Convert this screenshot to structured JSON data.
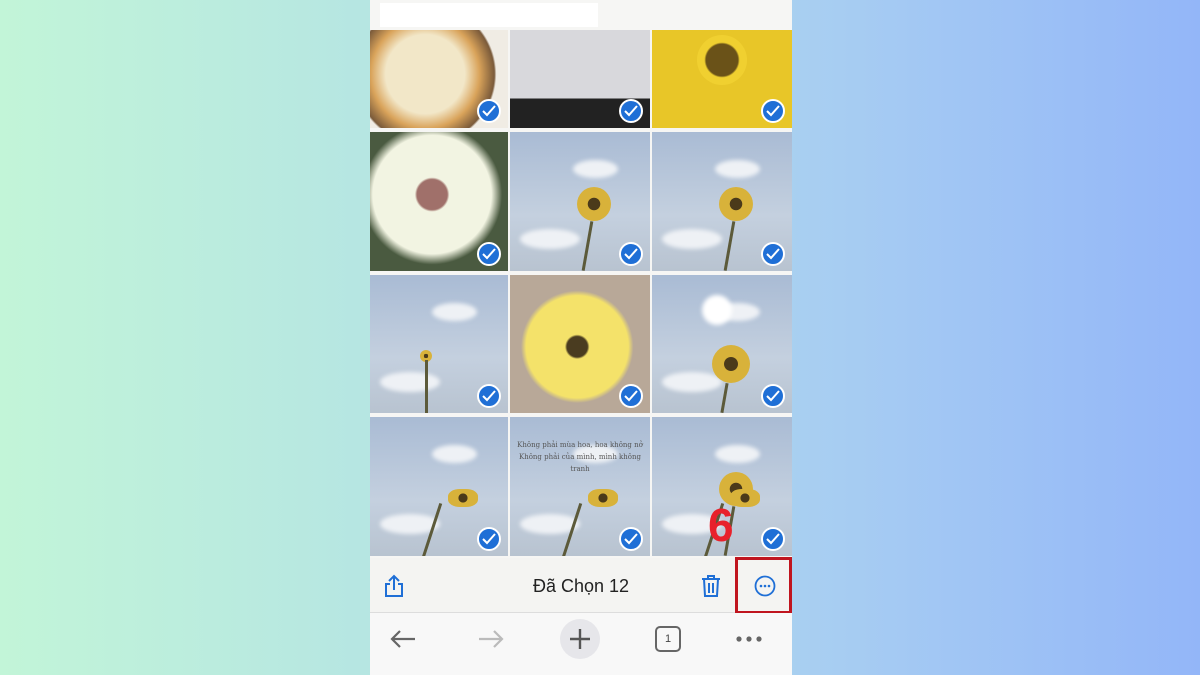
{
  "toolbar": {
    "title": "Đã Chọn 12",
    "share": "share-icon",
    "delete": "trash-icon",
    "more": "ellipsis-circle-icon"
  },
  "photos": {
    "selected_count": 12,
    "caption_line1": "Không phải mùa hoa, hoa không nở",
    "caption_line2": "Không phải của mình, mình không tranh"
  },
  "nav": {
    "tab_count": "1",
    "back": "arrow-left-icon",
    "forward": "arrow-right-icon",
    "new_tab": "plus-icon",
    "more": "more-dots-icon"
  },
  "annotation": {
    "step": "6",
    "color": "#e8212b"
  },
  "colors": {
    "accent": "#1f6fd6",
    "highlight": "#c0151f"
  }
}
